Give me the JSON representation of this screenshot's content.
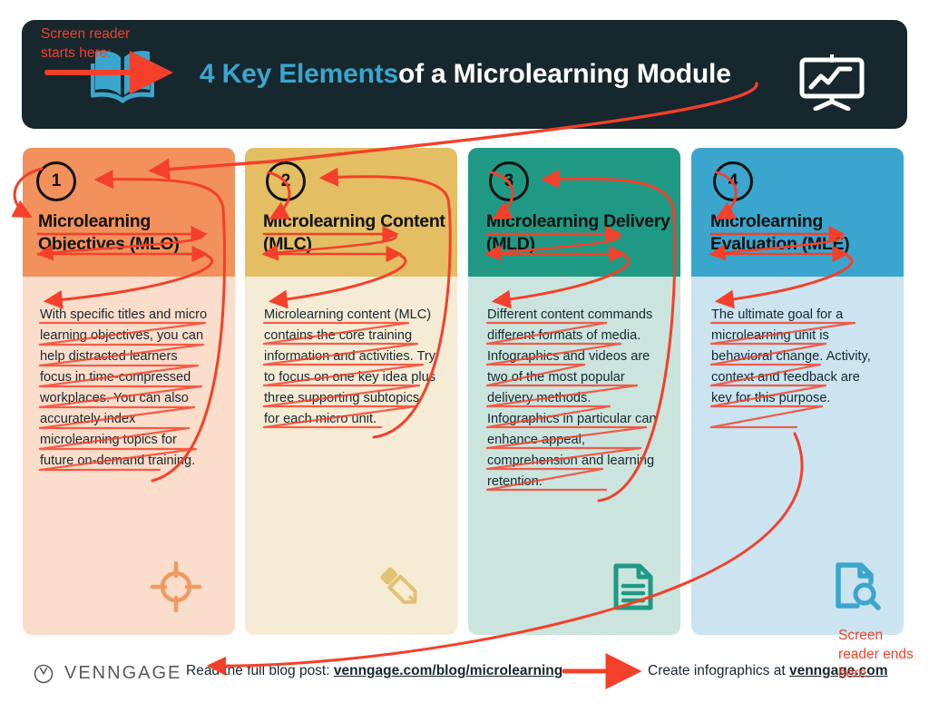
{
  "header": {
    "title_accent": "4 Key Elements",
    "title_rest": " of a Microlearning Module",
    "book_icon": "open-book-icon",
    "board_icon": "presentation-chart-icon",
    "bg_color": "#17272e",
    "accent_color": "#3aa6cd"
  },
  "annotations": {
    "start_label": "Screen reader starts here:",
    "end_label": "Screen reader ends here.",
    "color": "#f4402a"
  },
  "columns": [
    {
      "number": "1",
      "title": "Microlearning Objectives (MLO)",
      "body": "With specific titles and micro learning objectives, you can help distracted learners focus in time-compressed workplaces. You can also accurately index microlearning topics for future on-demand training.",
      "icon": "crosshair-target-icon",
      "cap_color": "#f2915b",
      "body_color": "#fbddcb",
      "icon_color": "#ef9a61"
    },
    {
      "number": "2",
      "title": "Microlearning Content (MLC)",
      "body": "Microlearning content (MLC) contains the core training information and activities. Try to focus on one key idea plus three supporting subtopics for each micro unit.",
      "icon": "pencil-icon",
      "cap_color": "#e3be63",
      "body_color": "#f6ecd6",
      "icon_color": "#e2c173"
    },
    {
      "number": "3",
      "title": "Microlearning Delivery (MLD)",
      "body": "Different content commands different formats of media. Infographics and videos are two of the most popular delivery methods. Infographics in particular can enhance appeal, comprehension and learning retention.",
      "icon": "document-lines-icon",
      "cap_color": "#1f9984",
      "body_color": "#cbe5de",
      "icon_color": "#1f9984"
    },
    {
      "number": "4",
      "title": "Microlearning Evaluation (MLE)",
      "body": "The ultimate goal for a microlearning unit is behavioral change. Activity, context and feedback are key for this purpose.",
      "icon": "document-search-icon",
      "cap_color": "#3aa6cd",
      "body_color": "#cbe4f0",
      "icon_color": "#3aa6cd"
    }
  ],
  "footer": {
    "logo_icon": "venngage-clock-icon",
    "wordmark": "VENNGAGE",
    "left_prefix": "Read the full blog post: ",
    "left_link": "venngage.com/blog/microlearning",
    "right_prefix": "Create infographics at ",
    "right_link": "venngage.com"
  }
}
